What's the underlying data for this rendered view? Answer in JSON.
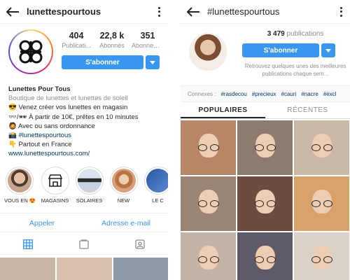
{
  "profile": {
    "username": "lunettespourtous",
    "stats": [
      {
        "num": "404",
        "label": "Publicati..."
      },
      {
        "num": "22,8 k",
        "label": "Abonnés"
      },
      {
        "num": "351",
        "label": "Abonnem..."
      }
    ],
    "follow_label": "S'abonner",
    "bio": {
      "name": "Lunettes Pour Tous",
      "category": "Boutique de lunettes et lunettes de soleil",
      "line1": "😎 Venez créer vos lunettes en magasin",
      "line2": "👓/🕶 À partir de 10€, prêtes en 10 minutes",
      "line3": "🧔 Avec ou sans ordonnance",
      "line4_prefix": "📸 ",
      "line4_tag": "#lunettespourtous",
      "line5": "👇 Partout en France",
      "website": "www.lunettespourtous.com/"
    },
    "highlights": [
      {
        "label": "VOUS EN 😍",
        "color": "#c8a48c"
      },
      {
        "label": "MAGASINS",
        "color": "#ffffff"
      },
      {
        "label": "SOLAIRES",
        "color": "#b9c7d8"
      },
      {
        "label": "NEW",
        "color": "#d9a07a"
      },
      {
        "label": "LE C",
        "color": "#3b6bb3"
      }
    ],
    "actions": {
      "call": "Appeler",
      "email": "Adresse e-mail"
    },
    "tabs": [
      "grid-icon",
      "igtv-icon",
      "tagged-icon"
    ]
  },
  "hashtag": {
    "title": "#lunettespourtous",
    "publications": "3 479",
    "publications_label": "publications",
    "follow_label": "S'abonner",
    "description": "Retrouvez quelques unes des meilleures publications chaque sem...",
    "related_label": "Connexes :",
    "related": [
      "#rasdecou",
      "#precieux",
      "#cauri",
      "#nacre",
      "#excl"
    ],
    "tabs": {
      "top": "POPULAIRES",
      "recent": "RÉCENTES"
    },
    "grid_colors": [
      "#b88566",
      "#8d7a70",
      "#c9b8a5",
      "#9a8474",
      "#6e4a3f",
      "#d8a36b",
      "#c2b3a6",
      "#5e5a68",
      "#d9d2c8"
    ]
  },
  "colors": {
    "accent": "#3897f0",
    "link": "#00376b",
    "muted": "#8e8e8e"
  }
}
